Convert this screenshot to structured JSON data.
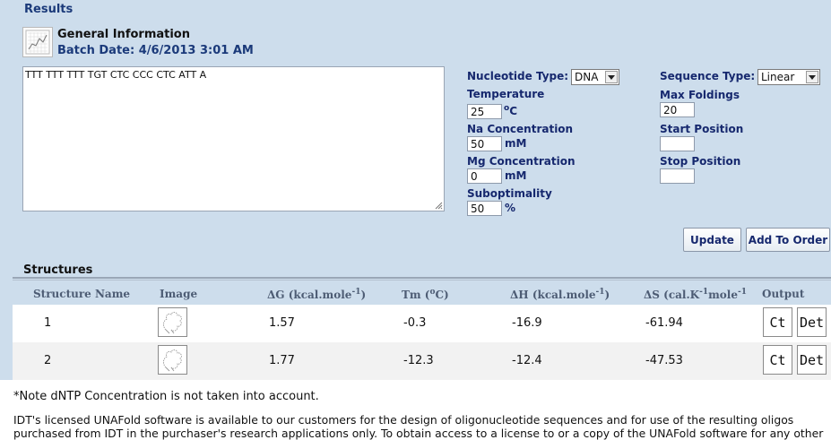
{
  "results": {
    "title": "Results"
  },
  "general_info": {
    "title": "General Information",
    "batch_date": "Batch Date: 4/6/2013 3:01 AM"
  },
  "sequence": "TTT TTT TTT TGT CTC CCC CTC ATT A",
  "params": {
    "nucleotide_type_label": "Nucleotide Type:",
    "nucleotide_type_value": "DNA",
    "sequence_type_label": "Sequence Type:",
    "sequence_type_value": "Linear",
    "temperature_label": "Temperature",
    "temperature_value": "25",
    "temperature_unit": "C",
    "temperature_unit_degree": "o",
    "max_foldings_label": "Max Foldings",
    "max_foldings_value": "20",
    "na_label": "Na Concentration",
    "na_value": "50",
    "na_unit": "mM",
    "start_label": "Start Position",
    "start_value": "",
    "mg_label": "Mg Concentration",
    "mg_value": "0",
    "mg_unit": "mM",
    "stop_label": "Stop Position",
    "stop_value": "",
    "subopt_label": "Suboptimality",
    "subopt_value": "50",
    "subopt_unit": "%"
  },
  "buttons": {
    "update": "Update",
    "add_to_order": "Add To Order"
  },
  "structures": {
    "title": "Structures",
    "headers": {
      "name": "Structure Name",
      "image": "Image",
      "dg": "ΔG (kcal.mole",
      "dg_sup": "-1",
      "dg_close": ")",
      "tm": "Tm (",
      "tm_sup": "o",
      "tm_close": "C)",
      "dh": "ΔH (kcal.mole",
      "dh_sup": "-1",
      "dh_close": ")",
      "ds": "ΔS (cal.K",
      "ds_sup1": "-1",
      "ds_mid": "mole",
      "ds_sup2": "-1",
      "output": "Output"
    },
    "rows": [
      {
        "name": "1",
        "dg": "1.57",
        "tm": "-0.3",
        "dh": "-16.9",
        "ds": "-61.94",
        "ct": "Ct",
        "det": "Det"
      },
      {
        "name": "2",
        "dg": "1.77",
        "tm": "-12.3",
        "dh": "-12.4",
        "ds": "-47.53",
        "ct": "Ct",
        "det": "Det"
      }
    ]
  },
  "notes": {
    "dntp": "*Note dNTP Concentration is not taken into account.",
    "line1": "IDT's licensed UNAFold software is available to our customers for the design of oligonucleotide sequences and for use of the resulting oligos",
    "line2": "purchased from IDT in the purchaser's research applications only. To obtain access to a license to or a copy of the UNAFold software for any other"
  },
  "colors": {
    "panel": "#cdddec",
    "label": "#16286e",
    "row_alt": "#f2f2f2"
  }
}
